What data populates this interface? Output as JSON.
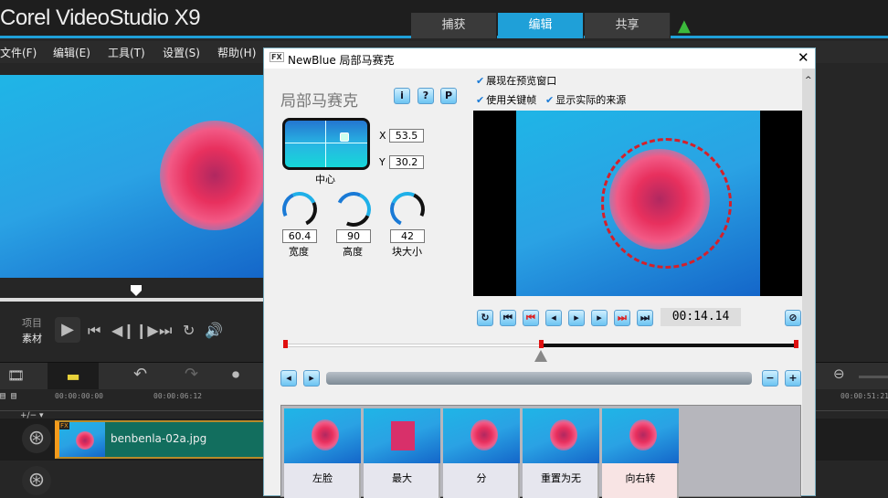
{
  "app": {
    "title": "Corel VideoStudio X9",
    "tabs": [
      "捕获",
      "编辑",
      "共享"
    ],
    "active_tab": "编辑"
  },
  "menu": [
    "文件(F)",
    "编辑(E)",
    "工具(T)",
    "设置(S)",
    "帮助(H)"
  ],
  "player": {
    "mode_project": "项目",
    "mode_clip": "素材"
  },
  "timeline": {
    "ruler": [
      "00:00:00:00",
      "00:00:06:12",
      "00:00:51:21"
    ],
    "add_remove": "+/− ▾",
    "clip_name": "benbenla-02a.jpg",
    "clip_badge": "FX"
  },
  "dialog": {
    "title": "NewBlue 局部马赛克",
    "effect_name": "局部马赛克",
    "info_buttons": [
      "i",
      "?",
      "P"
    ],
    "center_label": "中心",
    "x_label": "X",
    "x_value": "53.5",
    "y_label": "Y",
    "y_value": "30.2",
    "knobs": [
      {
        "label": "宽度",
        "value": "60.4"
      },
      {
        "label": "高度",
        "value": "90"
      },
      {
        "label": "块大小",
        "value": "42"
      }
    ],
    "checkboxes": [
      {
        "label": "展现在预览窗口",
        "checked": true
      },
      {
        "label": "使用关键帧",
        "checked": true
      },
      {
        "label": "显示实际的来源",
        "checked": true
      }
    ],
    "timecode": "00:14.14",
    "presets": [
      "左脸",
      "最大",
      "分",
      "重置为无",
      "向右转"
    ]
  },
  "colors": {
    "accent": "#1fa0d8",
    "clip": "#126e5e",
    "keyframe": "#e01010"
  }
}
